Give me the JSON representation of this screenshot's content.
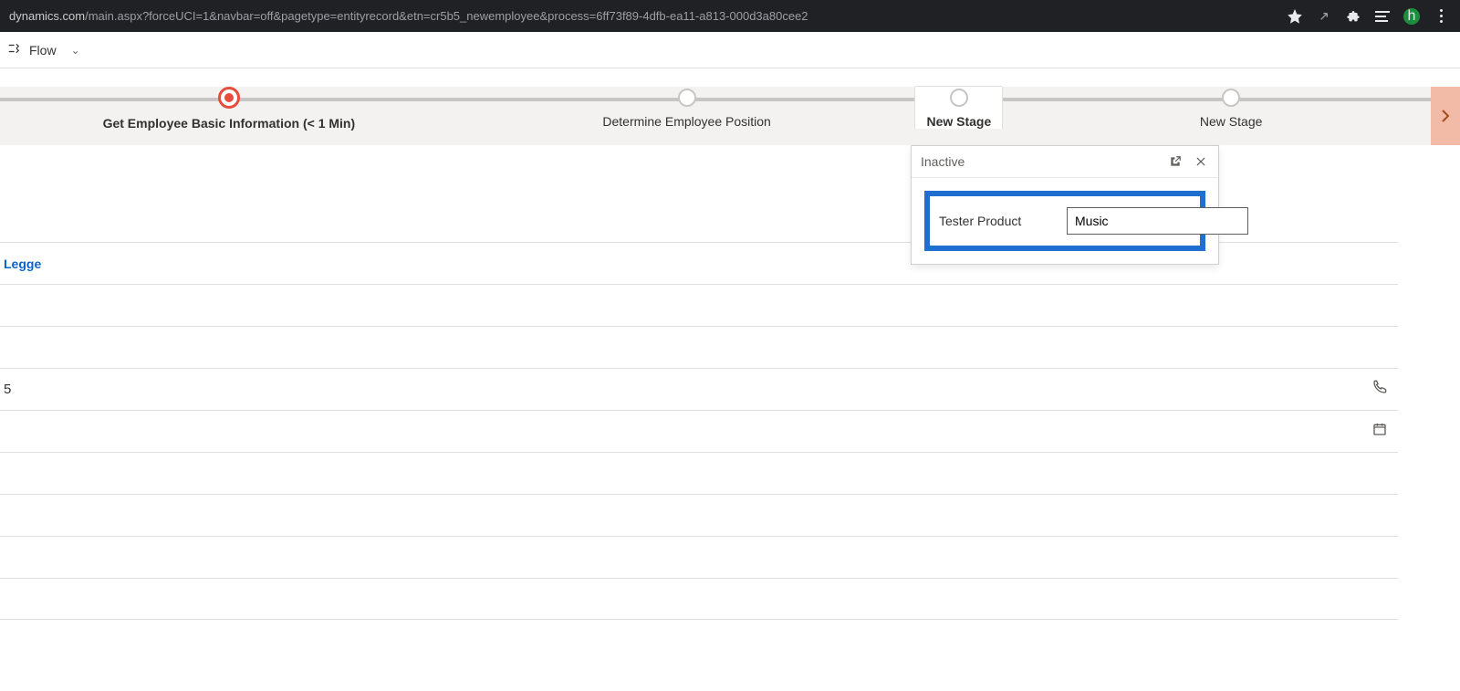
{
  "browser": {
    "url_prefix": "dynamics.com",
    "url_path": "/main.aspx?forceUCI=1&navbar=off&pagetype=entityrecord&etn=cr5b5_newemployee&process=6ff73f89-4dfb-ea11-a813-000d3a80cee2",
    "avatar_letter": "h"
  },
  "commandbar": {
    "flow_label": "Flow"
  },
  "process": {
    "stages": [
      {
        "label": "Get Employee Basic Information  (< 1 Min)"
      },
      {
        "label": "Determine Employee Position"
      },
      {
        "label": "New Stage"
      },
      {
        "label": "New Stage"
      }
    ]
  },
  "flyout": {
    "status": "Inactive",
    "field_label": "Tester Product",
    "field_value": "Music"
  },
  "form": {
    "link_name": "Legge",
    "phone_value": "5"
  }
}
